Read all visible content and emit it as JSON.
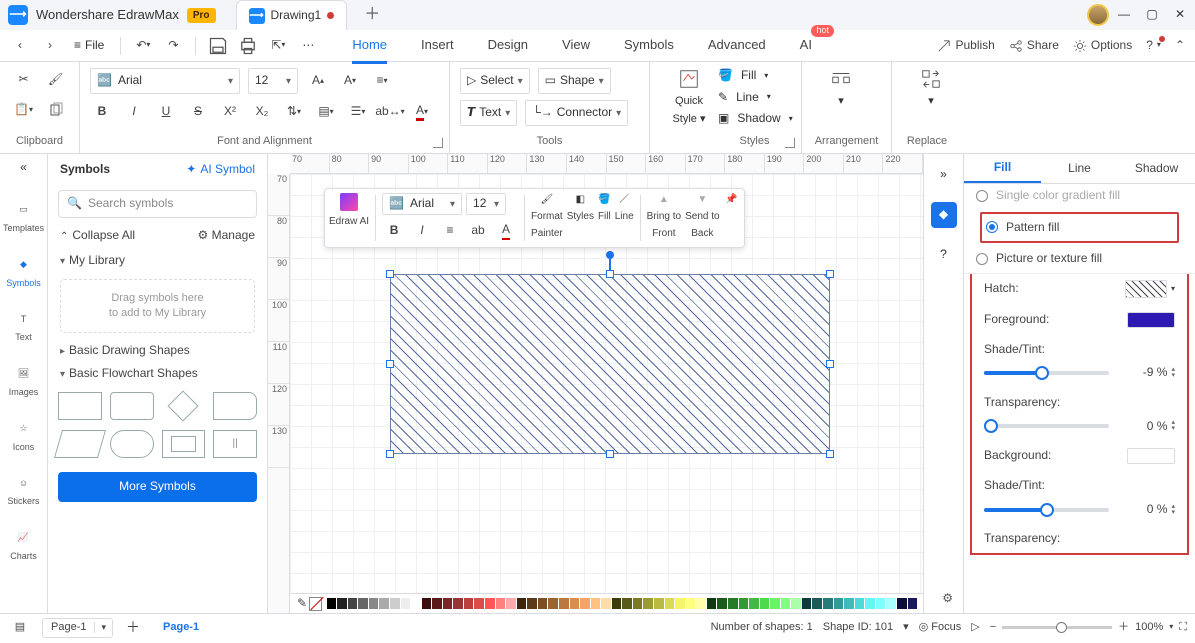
{
  "app": {
    "name": "Wondershare EdrawMax",
    "badge": "Pro",
    "doc_tab": "Drawing1"
  },
  "quick_access": {
    "file": "File"
  },
  "menus": {
    "home": "Home",
    "insert": "Insert",
    "design": "Design",
    "view": "View",
    "symbols": "Symbols",
    "advanced": "Advanced",
    "ai": "AI",
    "ai_badge": "hot"
  },
  "right_links": {
    "publish": "Publish",
    "share": "Share",
    "options": "Options"
  },
  "ribbon": {
    "clipboard": {
      "label": "Clipboard"
    },
    "font": {
      "label": "Font and Alignment",
      "family": "Arial",
      "size": "12"
    },
    "tools": {
      "label": "Tools",
      "select": "Select",
      "shape": "Shape",
      "text": "Text",
      "connector": "Connector"
    },
    "quickstyle": {
      "label1": "Quick",
      "label2": "Style"
    },
    "styles": {
      "label": "Styles",
      "fill": "Fill",
      "line": "Line",
      "shadow": "Shadow"
    },
    "arrangement": {
      "label": "Arrangement"
    },
    "replace": {
      "label": "Replace"
    }
  },
  "ctx": {
    "edraw_ai": "Edraw AI",
    "font": "Arial",
    "size": "12",
    "format_painter1": "Format",
    "format_painter2": "Painter",
    "styles": "Styles",
    "fill": "Fill",
    "line": "Line",
    "btf1": "Bring to",
    "btf2": "Front",
    "stb1": "Send to",
    "stb2": "Back"
  },
  "leftstrip": {
    "templates": "Templates",
    "symbols": "Symbols",
    "text": "Text",
    "images": "Images",
    "icons": "Icons",
    "stickers": "Stickers",
    "charts": "Charts"
  },
  "leftpanel": {
    "title": "Symbols",
    "ai": "AI Symbol",
    "search_ph": "Search symbols",
    "collapse": "Collapse All",
    "manage": "Manage",
    "mylib": "My Library",
    "drop1": "Drag symbols here",
    "drop2": "to add to My Library",
    "sec1": "Basic Drawing Shapes",
    "sec2": "Basic Flowchart Shapes",
    "more": "More Symbols"
  },
  "ruler_h": [
    "70",
    "80",
    "90",
    "100",
    "110",
    "120",
    "130",
    "140",
    "150",
    "160",
    "170",
    "180",
    "190",
    "200",
    "210",
    "220"
  ],
  "ruler_v": [
    "70",
    "80",
    "90",
    "100",
    "110",
    "120",
    "130"
  ],
  "right_tabs": {
    "fill": "Fill",
    "line": "Line",
    "shadow": "Shadow"
  },
  "fill_opts": {
    "grad": "Single color gradient fill",
    "pattern": "Pattern fill",
    "picture": "Picture or texture fill"
  },
  "controls": {
    "hatch": "Hatch:",
    "foreground": "Foreground:",
    "shade_tint": "Shade/Tint:",
    "transparency": "Transparency:",
    "background": "Background:",
    "fg_shade_val": "-9 %",
    "fg_trans_val": "0 %",
    "bg_shade_val": "0 %"
  },
  "status": {
    "page_dd": "Page-1",
    "page_tab": "Page-1",
    "shapes": "Number of shapes: 1",
    "shape_id": "Shape ID: 101",
    "focus": "Focus",
    "zoom": "100%"
  }
}
